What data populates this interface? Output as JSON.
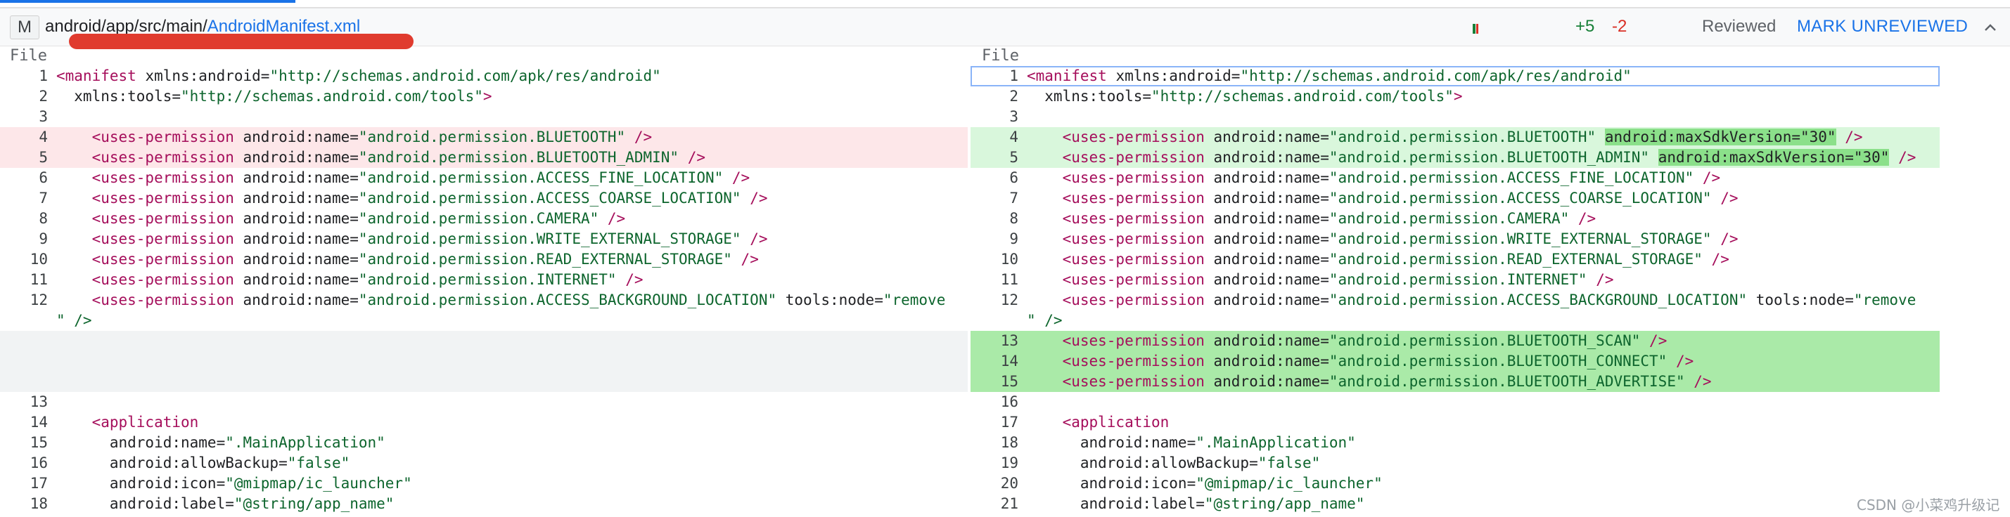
{
  "header": {
    "status_letter": "M",
    "path_prefix": "android/app/src/main/",
    "file_name": "AndroidManifest.xml",
    "added": "+5",
    "removed": "-2",
    "reviewed_label": "Reviewed",
    "mark_button": "MARK UNREVIEWED"
  },
  "columns": {
    "left": "File",
    "right": "File"
  },
  "colors": {
    "deleted_bg": "#fde7e9",
    "added_bg": "#d9f7dc",
    "added_strong_bg": "#aaeaa8",
    "tag": "#a50e5b",
    "string": "#0d652d",
    "link": "#1a73e8"
  },
  "left_lines": [
    {
      "n": "1",
      "t": "manifest_open"
    },
    {
      "n": "2",
      "t": "tools_ns"
    },
    {
      "n": "3",
      "t": "blank"
    },
    {
      "n": "4",
      "t": "perm_bt"
    },
    {
      "n": "5",
      "t": "perm_bt_admin"
    },
    {
      "n": "6",
      "t": "perm_fine"
    },
    {
      "n": "7",
      "t": "perm_coarse"
    },
    {
      "n": "8",
      "t": "perm_camera"
    },
    {
      "n": "9",
      "t": "perm_wext"
    },
    {
      "n": "10",
      "t": "perm_rext"
    },
    {
      "n": "11",
      "t": "perm_internet"
    },
    {
      "n": "12",
      "t": "perm_bg"
    },
    {
      "n": "13",
      "t": "blank"
    },
    {
      "n": "14",
      "t": "app_open"
    },
    {
      "n": "15",
      "t": "app_name"
    },
    {
      "n": "16",
      "t": "app_backup"
    },
    {
      "n": "17",
      "t": "app_icon"
    },
    {
      "n": "18",
      "t": "app_label"
    }
  ],
  "right_lines": [
    {
      "n": "1"
    },
    {
      "n": "2"
    },
    {
      "n": "3"
    },
    {
      "n": "4"
    },
    {
      "n": "5"
    },
    {
      "n": "6"
    },
    {
      "n": "7"
    },
    {
      "n": "8"
    },
    {
      "n": "9"
    },
    {
      "n": "10"
    },
    {
      "n": "11"
    },
    {
      "n": "12"
    },
    {
      "n": "13"
    },
    {
      "n": "14"
    },
    {
      "n": "15"
    },
    {
      "n": "16"
    },
    {
      "n": "17"
    },
    {
      "n": "18"
    },
    {
      "n": "19"
    },
    {
      "n": "20"
    },
    {
      "n": "21"
    }
  ],
  "code": {
    "manifest_tag": "<manifest",
    "manifest_attr": " xmlns:android=",
    "manifest_val": "\"http://schemas.android.com/apk/res/android\"",
    "tools_attr": "  xmlns:tools=",
    "tools_val": "\"http://schemas.android.com/tools\"",
    "tools_end": ">",
    "perm_tag": "    <uses-permission",
    "name_attr": " android:name=",
    "close": " />",
    "max_sdk": "android:maxSdkVersion=\"30\"",
    "perm_bt": "\"android.permission.BLUETOOTH\"",
    "perm_bt_admin": "\"android.permission.BLUETOOTH_ADMIN\"",
    "perm_fine": "\"android.permission.ACCESS_FINE_LOCATION\"",
    "perm_coarse": "\"android.permission.ACCESS_COARSE_LOCATION\"",
    "perm_camera": "\"android.permission.CAMERA\"",
    "perm_wext": "\"android.permission.WRITE_EXTERNAL_STORAGE\"",
    "perm_rext": "\"android.permission.READ_EXTERNAL_STORAGE\"",
    "perm_internet": "\"android.permission.INTERNET\"",
    "perm_bg": "\"android.permission.ACCESS_BACKGROUND_LOCATION\"",
    "tools_node": " tools:node=",
    "remove_val": "\"remove",
    "remove_cont": "\" />",
    "perm_scan": "\"android.permission.BLUETOOTH_SCAN\"",
    "perm_connect": "\"android.permission.BLUETOOTH_CONNECT\"",
    "perm_advertise": "\"android.permission.BLUETOOTH_ADVERTISE\"",
    "app_tag": "    <application",
    "app_name_attr": "      android:name=",
    "app_name_val": "\".MainApplication\"",
    "app_backup_attr": "      android:allowBackup=",
    "app_backup_val": "\"false\"",
    "app_icon_attr": "      android:icon=",
    "app_icon_val": "\"@mipmap/ic_launcher\"",
    "app_label_attr": "      android:label=",
    "app_label_val": "\"@string/app_name\""
  },
  "watermark": "CSDN @小菜鸡升级记"
}
